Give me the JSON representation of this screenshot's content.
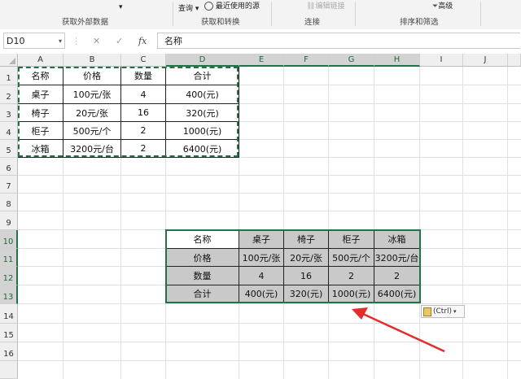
{
  "ribbon": {
    "query_label": "查询",
    "recent_sources_label": "最近使用的源",
    "edit_links_label": "编辑链接",
    "advanced_label": "高级",
    "groups": [
      "获取外部数据",
      "获取和转换",
      "连接",
      "排序和筛选"
    ]
  },
  "formula_bar": {
    "name_box": "D10",
    "cancel": "✕",
    "confirm": "✓",
    "fx": "fx",
    "content": "名称"
  },
  "columns": [
    "A",
    "B",
    "C",
    "D",
    "E",
    "F",
    "G",
    "H",
    "I",
    "J"
  ],
  "rows": [
    "1",
    "2",
    "3",
    "4",
    "5",
    "6",
    "7",
    "8",
    "9",
    "10",
    "11",
    "12",
    "13",
    "14",
    "15",
    "16"
  ],
  "table1": {
    "header": [
      "名称",
      "价格",
      "数量",
      "合计"
    ],
    "rows": [
      [
        "桌子",
        "100元/张",
        "4",
        "400(元)"
      ],
      [
        "椅子",
        "20元/张",
        "16",
        "320(元)"
      ],
      [
        "柜子",
        "500元/个",
        "2",
        "1000(元)"
      ],
      [
        "冰箱",
        "3200元/台",
        "2",
        "6400(元)"
      ]
    ]
  },
  "table2": {
    "rows": [
      [
        "名称",
        "桌子",
        "椅子",
        "柜子",
        "冰箱"
      ],
      [
        "价格",
        "100元/张",
        "20元/张",
        "500元/个",
        "3200元/台"
      ],
      [
        "数量",
        "4",
        "16",
        "2",
        "2"
      ],
      [
        "合计",
        "400(元)",
        "320(元)",
        "1000(元)",
        "6400(元)"
      ]
    ]
  },
  "paste_options": {
    "label": "(Ctrl)"
  },
  "colors": {
    "accent": "#217346",
    "arrow": "#e52b2b",
    "shade": "#c9c9c9"
  }
}
